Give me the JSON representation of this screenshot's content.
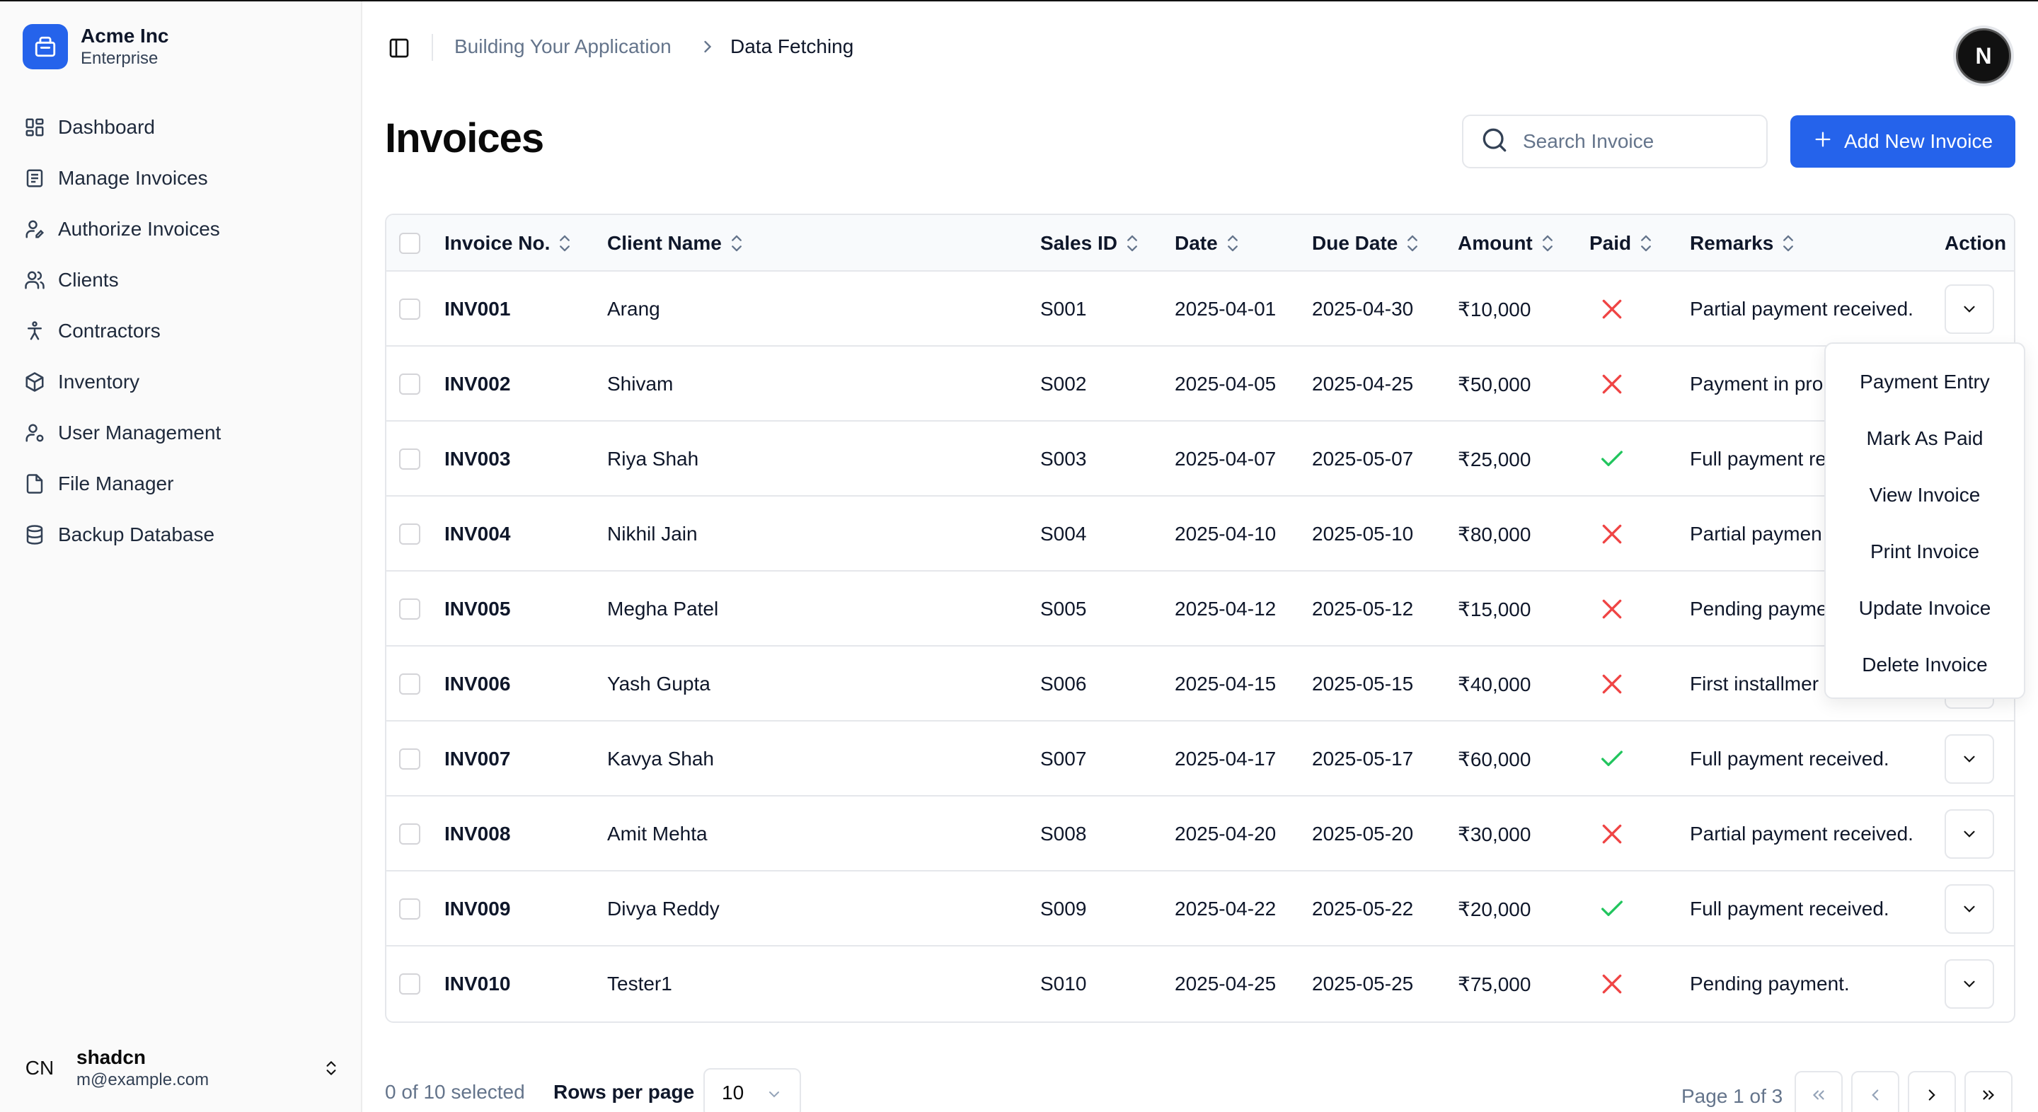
{
  "brand": {
    "name": "Acme Inc",
    "plan": "Enterprise"
  },
  "nav": [
    {
      "label": "Dashboard",
      "icon": "dashboard-icon"
    },
    {
      "label": "Manage Invoices",
      "icon": "receipt-icon"
    },
    {
      "label": "Authorize Invoices",
      "icon": "user-pen-icon"
    },
    {
      "label": "Clients",
      "icon": "users-icon"
    },
    {
      "label": "Contractors",
      "icon": "person-icon"
    },
    {
      "label": "Inventory",
      "icon": "package-icon"
    },
    {
      "label": "User Management",
      "icon": "user-cog-icon"
    },
    {
      "label": "File Manager",
      "icon": "file-icon"
    },
    {
      "label": "Backup Database",
      "icon": "database-icon"
    }
  ],
  "user": {
    "initials": "CN",
    "name": "shadcn",
    "email": "m@example.com"
  },
  "breadcrumb": {
    "parent": "Building Your Application",
    "current": "Data Fetching"
  },
  "avatar_letter": "N",
  "page_title": "Invoices",
  "search": {
    "placeholder": "Search Invoice"
  },
  "add_button": "Add New Invoice",
  "columns": {
    "invoice_no": "Invoice No.",
    "client": "Client Name",
    "sales_id": "Sales ID",
    "date": "Date",
    "due_date": "Due Date",
    "amount": "Amount",
    "paid": "Paid",
    "remarks": "Remarks",
    "action": "Action"
  },
  "rows": [
    {
      "invoice": "INV001",
      "client": "Arang",
      "sales_id": "S001",
      "date": "2025-04-01",
      "due": "2025-04-30",
      "amount": "₹10,000",
      "paid": false,
      "remarks": "Partial payment received."
    },
    {
      "invoice": "INV002",
      "client": "Shivam",
      "sales_id": "S002",
      "date": "2025-04-05",
      "due": "2025-04-25",
      "amount": "₹50,000",
      "paid": false,
      "remarks": "Payment in pro"
    },
    {
      "invoice": "INV003",
      "client": "Riya Shah",
      "sales_id": "S003",
      "date": "2025-04-07",
      "due": "2025-05-07",
      "amount": "₹25,000",
      "paid": true,
      "remarks": "Full payment re"
    },
    {
      "invoice": "INV004",
      "client": "Nikhil Jain",
      "sales_id": "S004",
      "date": "2025-04-10",
      "due": "2025-05-10",
      "amount": "₹80,000",
      "paid": false,
      "remarks": "Partial paymen"
    },
    {
      "invoice": "INV005",
      "client": "Megha Patel",
      "sales_id": "S005",
      "date": "2025-04-12",
      "due": "2025-05-12",
      "amount": "₹15,000",
      "paid": false,
      "remarks": "Pending payme"
    },
    {
      "invoice": "INV006",
      "client": "Yash Gupta",
      "sales_id": "S006",
      "date": "2025-04-15",
      "due": "2025-05-15",
      "amount": "₹40,000",
      "paid": false,
      "remarks": "First installmer"
    },
    {
      "invoice": "INV007",
      "client": "Kavya Shah",
      "sales_id": "S007",
      "date": "2025-04-17",
      "due": "2025-05-17",
      "amount": "₹60,000",
      "paid": true,
      "remarks": "Full payment received."
    },
    {
      "invoice": "INV008",
      "client": "Amit Mehta",
      "sales_id": "S008",
      "date": "2025-04-20",
      "due": "2025-05-20",
      "amount": "₹30,000",
      "paid": false,
      "remarks": "Partial payment received."
    },
    {
      "invoice": "INV009",
      "client": "Divya Reddy",
      "sales_id": "S009",
      "date": "2025-04-22",
      "due": "2025-05-22",
      "amount": "₹20,000",
      "paid": true,
      "remarks": "Full payment received."
    },
    {
      "invoice": "INV010",
      "client": "Tester1",
      "sales_id": "S010",
      "date": "2025-04-25",
      "due": "2025-05-25",
      "amount": "₹75,000",
      "paid": false,
      "remarks": "Pending payment."
    }
  ],
  "action_menu": [
    "Payment Entry",
    "Mark As Paid",
    "View Invoice",
    "Print Invoice",
    "Update Invoice",
    "Delete Invoice"
  ],
  "footer": {
    "selected": "0 of 10 selected",
    "rows_per_page_label": "Rows per page",
    "rows_per_page_value": "10",
    "page_info": "Page 1 of 3"
  },
  "colors": {
    "accent": "#2563eb",
    "paid": "#22c55e",
    "unpaid": "#ef4444"
  }
}
